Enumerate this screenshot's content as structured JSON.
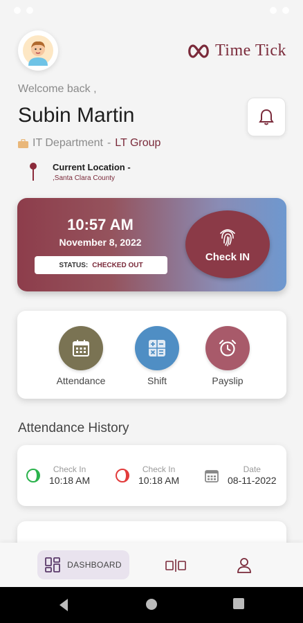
{
  "header": {
    "brand_name": "Time Tick",
    "welcome": "Welcome back ,",
    "user_name": "Subin Martin",
    "department": "IT Department",
    "separator": "-",
    "group": "LT Group",
    "location_label": "Current Location -",
    "location_value": ",Santa Clara County"
  },
  "clock": {
    "time": "10:57 AM",
    "date": "November 8, 2022",
    "status_label": "STATUS:",
    "status_value": "CHECKED OUT",
    "check_in_label": "Check IN"
  },
  "actions": [
    {
      "label": "Attendance",
      "icon": "calendar-icon",
      "color": "#7a7353"
    },
    {
      "label": "Shift",
      "icon": "calculator-icon",
      "color": "#4f8ec4"
    },
    {
      "label": "Payslip",
      "icon": "alarm-clock-icon",
      "color": "#a85a6a"
    }
  ],
  "history": {
    "title": "Attendance History",
    "rows": [
      {
        "check_in_1": {
          "caption": "Check In",
          "value": "10:18 AM",
          "color": "#2bb24c"
        },
        "check_in_2": {
          "caption": "Check In",
          "value": "10:18 AM",
          "color": "#e23b3b"
        },
        "date": {
          "caption": "Date",
          "value": "08-11-2022"
        }
      }
    ]
  },
  "bottom_nav": {
    "dashboard_label": "DASHBOARD"
  },
  "colors": {
    "brand": "#7a2a3a",
    "accent_bg": "#e9e3ee"
  }
}
